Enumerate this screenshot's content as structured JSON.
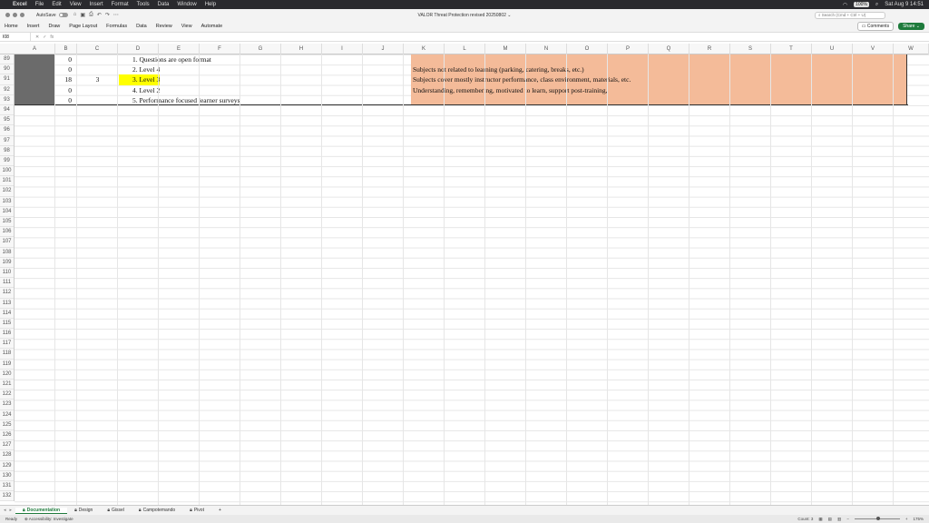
{
  "menubar": {
    "items": [
      "Excel",
      "File",
      "Edit",
      "View",
      "Insert",
      "Format",
      "Tools",
      "Data",
      "Window",
      "Help"
    ],
    "battery": "100%",
    "datetime": "Sat Aug 9  14:51"
  },
  "titlebar": {
    "autosave_label": "AutoSave",
    "title": "VALOR Threat Protection revised 20250802 ⌄",
    "search_placeholder": "Search (Cmd + Ctrl + U)"
  },
  "ribbon": {
    "tabs": [
      "Home",
      "Insert",
      "Draw",
      "Page Layout",
      "Formulas",
      "Data",
      "Review",
      "View",
      "Automate"
    ],
    "comments_label": "Comments",
    "share_label": "Share ⌄"
  },
  "formula_bar": {
    "name_box": "I08",
    "fx": "fx"
  },
  "columns": [
    "A",
    "B",
    "C",
    "D",
    "E",
    "F",
    "G",
    "H",
    "I",
    "J",
    "K",
    "L",
    "M",
    "N",
    "O",
    "P",
    "Q",
    "R",
    "S",
    "T",
    "U",
    "V",
    "W"
  ],
  "rows": [
    "89",
    "90",
    "91",
    "92",
    "93",
    "94",
    "95",
    "96",
    "97",
    "98",
    "99",
    "100",
    "101",
    "102",
    "103",
    "104",
    "105",
    "106",
    "107",
    "108",
    "109",
    "110",
    "111",
    "112",
    "113",
    "114",
    "115",
    "116",
    "117",
    "118",
    "119",
    "120",
    "121",
    "122",
    "123",
    "124",
    "125",
    "126",
    "127",
    "128",
    "129",
    "130",
    "131",
    "132"
  ],
  "cells": {
    "b89": "0",
    "b90": "0",
    "b91": "18",
    "b92": "0",
    "b93": "0",
    "c91": "3",
    "d89": "1.  Questions are open format",
    "d90": "2.  Level 4",
    "d91": "3.  Level 3",
    "d92": "4.  Level 2",
    "d93": "5.  Performance focused learner surveys",
    "k90": "Subjects not related to learning (parking, catering, breaks, etc.)",
    "k91": "Subjects cover mostly instructor performance, class environment, materials, etc.",
    "k92": "Understanding, remembering, motivated to learn, support post-training,"
  },
  "sheets": [
    "Documentation",
    "Design",
    "Gissel",
    "Campotemando",
    "Pivot"
  ],
  "status": {
    "ready": "Ready",
    "accessibility": "Accessibility: Investigate",
    "count": "Count: 3",
    "zoom": "175%"
  },
  "colors": {
    "peach": "#f4bb99",
    "highlight": "#ffff00",
    "gray_block": "#6b6b6b",
    "share_green": "#1e7b3c"
  }
}
